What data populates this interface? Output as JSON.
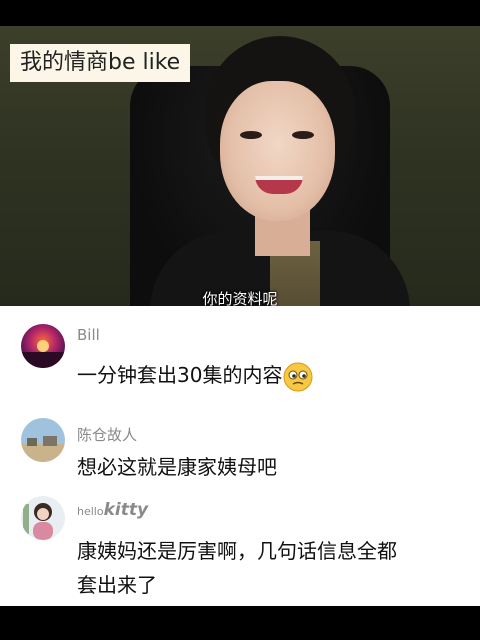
{
  "video": {
    "overlay_title": "我的情商be like",
    "subtitle": "你的资料呢"
  },
  "comments": [
    {
      "username": "Bill",
      "text": "一分钟套出30集的内容",
      "emoji": "thinking-face-icon"
    },
    {
      "username": "陈仓故人",
      "text": "想必这就是康家姨母吧"
    },
    {
      "username_prefix": "hello",
      "username_suffix": "kitty",
      "text_line1": "康姨妈还是厉害啊，几句话信息全都",
      "text_line2": "套出来了"
    }
  ],
  "colors": {
    "background": "#000000",
    "panel": "#ffffff",
    "username": "#8a8a8a",
    "text": "#111111",
    "tag_bg": "#fbf6e8"
  }
}
